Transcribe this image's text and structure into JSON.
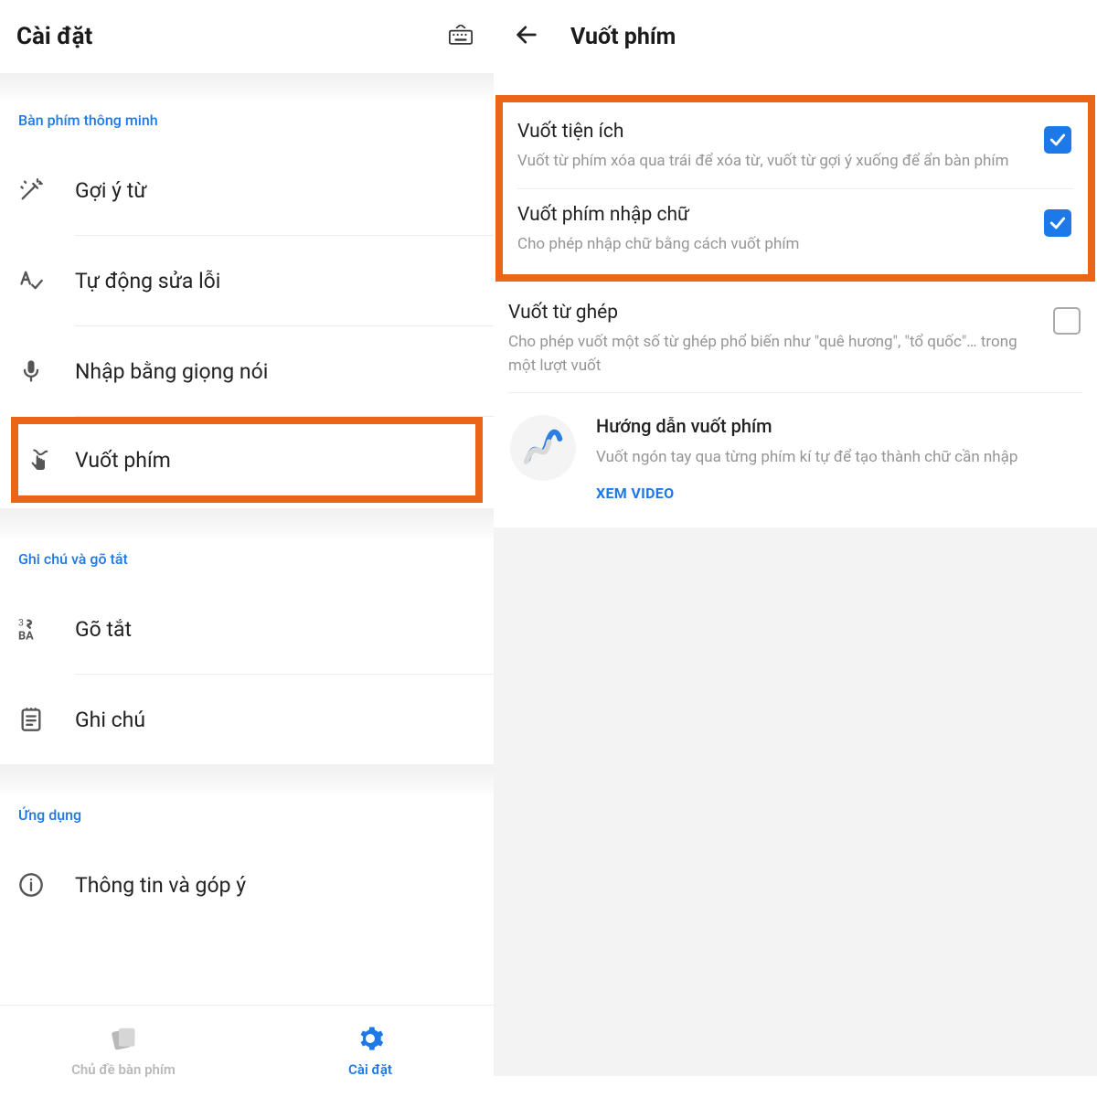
{
  "left": {
    "title": "Cài đặt",
    "sections": {
      "smart": {
        "label": "Bàn phím thông minh",
        "items": [
          {
            "label": "Gợi ý từ"
          },
          {
            "label": "Tự động sửa lỗi"
          },
          {
            "label": "Nhập bằng giọng nói"
          },
          {
            "label": "Vuốt phím"
          }
        ]
      },
      "notes": {
        "label": "Ghi chú và gõ tắt",
        "items": [
          {
            "label": "Gõ tắt"
          },
          {
            "label": "Ghi chú"
          }
        ]
      },
      "app": {
        "label": "Ứng dụng",
        "items": [
          {
            "label": "Thông tin và góp ý"
          }
        ]
      }
    },
    "tabs": {
      "themes": "Chủ đề bàn phím",
      "settings": "Cài đặt"
    }
  },
  "right": {
    "title": "Vuốt phím",
    "options": [
      {
        "title": "Vuốt tiện ích",
        "desc": "Vuốt từ phím xóa qua trái để xóa từ, vuốt từ gợi ý xuống để ẩn bàn phím",
        "checked": true
      },
      {
        "title": "Vuốt phím nhập chữ",
        "desc": "Cho phép nhập chữ bằng cách vuốt phím",
        "checked": true
      },
      {
        "title": "Vuốt từ ghép",
        "desc": "Cho phép vuốt một số từ ghép phổ biến như \"quê hương\", \"tổ quốc\"… trong một lượt vuốt",
        "checked": false
      }
    ],
    "guide": {
      "title": "Hướng dẫn vuốt phím",
      "desc": "Vuốt ngón tay qua từng phím kí tự để tạo thành chữ cần nhập",
      "link": "XEM VIDEO"
    }
  }
}
